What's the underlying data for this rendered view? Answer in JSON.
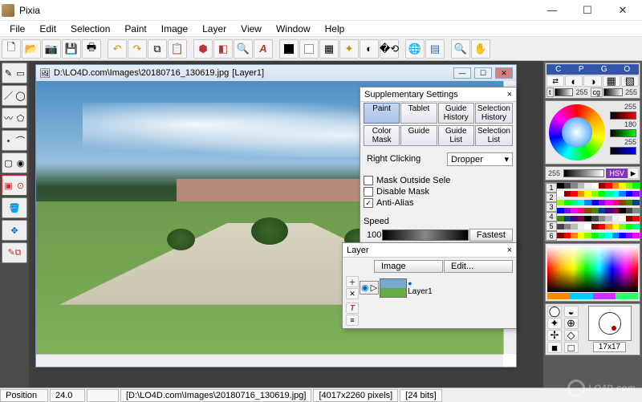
{
  "app": {
    "title": "Pixia"
  },
  "window_controls": {
    "min": "—",
    "max": "☐",
    "close": "✕"
  },
  "menu": [
    "File",
    "Edit",
    "Selection",
    "Paint",
    "Image",
    "Layer",
    "View",
    "Window",
    "Help"
  ],
  "toolbar_icons": [
    "new",
    "open",
    "camera",
    "save",
    "print",
    "undo",
    "redo",
    "copy",
    "paste",
    "stamp",
    "eraser",
    "zoom-tool",
    "text-a",
    "fg-color",
    "bg-color",
    "grid",
    "sparkle",
    "color-adjust",
    "transform",
    "globe",
    "layers-panel",
    "magnify",
    "hand"
  ],
  "fgbg": {
    "fg": "#000000",
    "bg": "#ffffff"
  },
  "side_tools": [
    [
      "pencil",
      "rect-select"
    ],
    [
      "line",
      "oval-select"
    ],
    [
      "free",
      "poly"
    ],
    [
      "wand",
      "lasso"
    ],
    [
      "shape",
      "closed-shape"
    ],
    [
      "select-box",
      "magnet"
    ],
    [
      "bucket",
      ""
    ],
    [
      "move",
      ""
    ],
    [
      "clone",
      ""
    ]
  ],
  "document": {
    "icon": "image-icon",
    "path": "D:\\LO4D.com\\Images\\20180716_130619.jpg",
    "layer_suffix": "[Layer1]"
  },
  "supplementary": {
    "title": "Supplementary Settings",
    "tabs_top": [
      "Paint",
      "Tablet",
      "Guide History",
      "Selection History"
    ],
    "tabs_bot": [
      "Color Mask",
      "Guide",
      "Guide List",
      "Selection List"
    ],
    "active_tab": "Paint",
    "right_click_label": "Right Clicking",
    "right_click_value": "Dropper",
    "checks": [
      {
        "label": "Mask Outside Sele",
        "checked": false
      },
      {
        "label": "Disable Mask",
        "checked": false
      },
      {
        "label": "Anti-Alias",
        "checked": true
      }
    ],
    "speed_label": "Speed",
    "speed_value": "100",
    "speed_button": "Fastest"
  },
  "layer_panel": {
    "title": "Layer",
    "buttons": [
      "Image",
      "Edit..."
    ],
    "entry": "Layer1"
  },
  "color_panel": {
    "top_letters": [
      "C",
      "P",
      "G",
      "O"
    ],
    "val_t": "255",
    "val_cg": "255",
    "ring_255": "255",
    "ring_180": "180",
    "ring_255b": "255",
    "bottom_255": "255",
    "hsv": "HSV"
  },
  "palette_nums": [
    "1",
    "2",
    "3",
    "4",
    "5",
    "6"
  ],
  "brush": {
    "size_label": "17x17"
  },
  "status": {
    "position_label": "Position",
    "zoom": "24.0",
    "blank": "",
    "file": "[D:\\LO4D.com\\Images\\20180716_130619.jpg]",
    "dims": "[4017x2260 pixels]",
    "bits": "[24 bits]"
  },
  "watermark": "LO4D.com"
}
